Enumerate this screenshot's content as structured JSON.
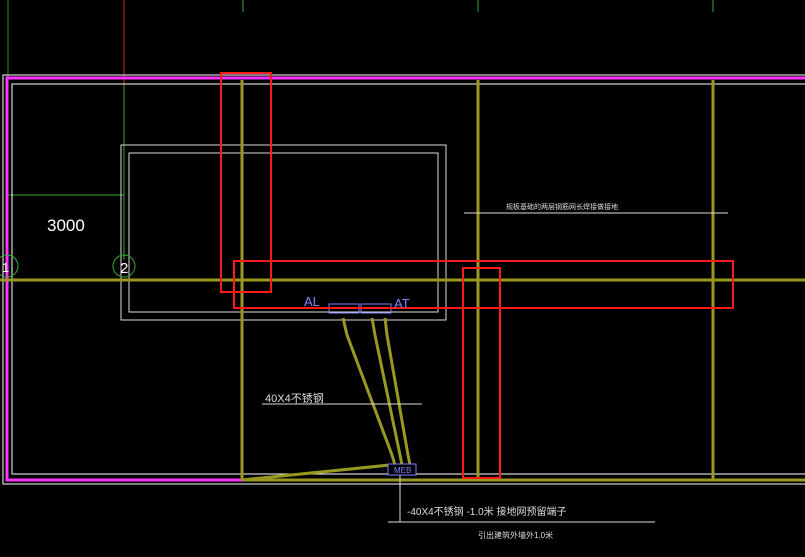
{
  "drawing": {
    "dimension_text": "3000",
    "grid_bubble_left": "1",
    "grid_bubble_2": "2",
    "panel_left": "AL",
    "panel_right": "AT",
    "meb_label": "MEB",
    "note_top": "规板基础的两层钢筋网长焊接做接地",
    "note_conductor": "40X4不锈钢",
    "note_bottom_1": "-40X4不锈钢 -1.0米  接地网预留端子",
    "note_bottom_2": "引出建筑外墙外1.0米"
  },
  "colors": {
    "background": "#000000",
    "wall_magenta": "#ff33ff",
    "ground_olive": "#999922",
    "highlight_red": "#ff1a1a",
    "outline_white": "#ffffff",
    "text_blue": "#8080ff",
    "grid_green": "#33cc33",
    "axis_red": "#cc2222"
  }
}
